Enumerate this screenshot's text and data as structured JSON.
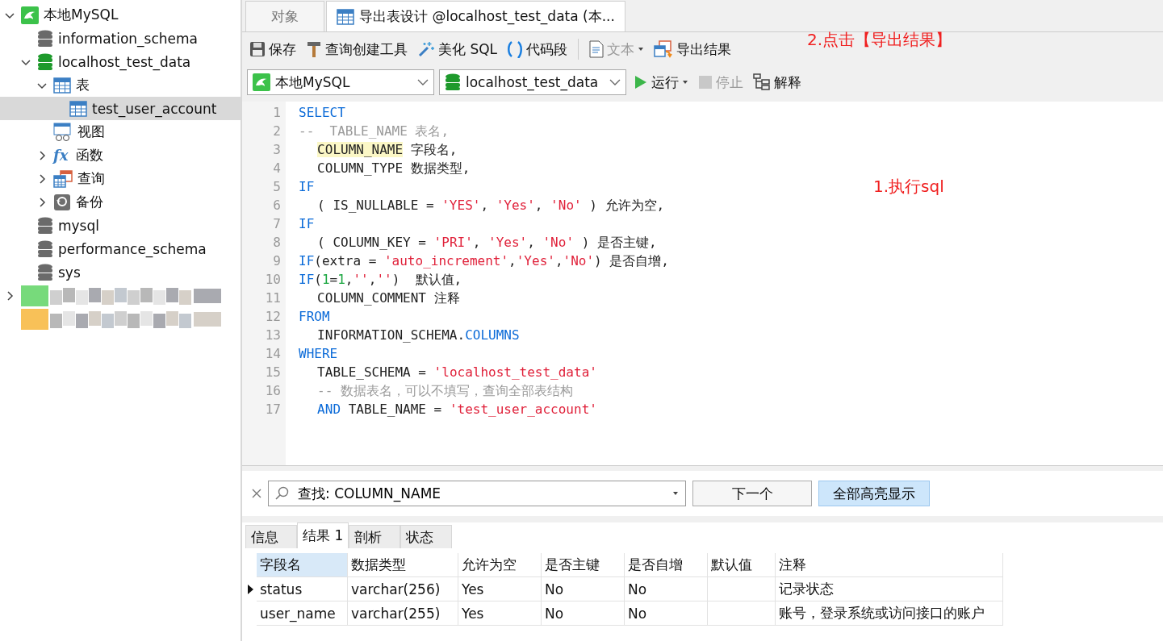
{
  "sidebar": {
    "tree": [
      {
        "label": "本地MySQL",
        "kind": "connection",
        "expanded": true,
        "selected": false,
        "children": [
          {
            "label": "information_schema",
            "kind": "database",
            "active": false,
            "selected": false
          },
          {
            "label": "localhost_test_data",
            "kind": "database",
            "active": true,
            "expanded": true,
            "selected": false,
            "children": [
              {
                "label": "表",
                "kind": "tables",
                "expanded": true,
                "selected": false,
                "children": [
                  {
                    "label": "test_user_account",
                    "kind": "table",
                    "selected": true
                  }
                ]
              },
              {
                "label": "视图",
                "kind": "views",
                "selected": false
              },
              {
                "label": "函数",
                "kind": "functions",
                "glyph": "fx",
                "expanded": false,
                "selected": false
              },
              {
                "label": "查询",
                "kind": "queries",
                "expanded": false,
                "selected": false
              },
              {
                "label": "备份",
                "kind": "backups",
                "expanded": false,
                "selected": false
              }
            ]
          },
          {
            "label": "mysql",
            "kind": "database",
            "active": false,
            "selected": false
          },
          {
            "label": "performance_schema",
            "kind": "database",
            "active": false,
            "selected": false
          },
          {
            "label": "sys",
            "kind": "database",
            "active": false,
            "selected": false
          }
        ]
      },
      {
        "kind": "redacted",
        "expanded": false
      },
      {
        "kind": "redacted"
      }
    ]
  },
  "tabs": [
    {
      "label": "对象",
      "selected": false,
      "icon": false
    },
    {
      "label": "导出表设计 @localhost_test_data (本...",
      "selected": true,
      "icon": true
    }
  ],
  "toolbar": [
    {
      "kind": "save",
      "label": "保存",
      "disabled": false
    },
    {
      "kind": "builder",
      "label": "查询创建工具",
      "disabled": false
    },
    {
      "kind": "beautify",
      "label": "美化 SQL",
      "disabled": false
    },
    {
      "kind": "snippet",
      "label": "代码段",
      "disabled": false
    },
    {
      "kind": "separator"
    },
    {
      "kind": "text",
      "label": "文本",
      "disabled": true,
      "dropdown": true
    },
    {
      "kind": "export",
      "label": "导出结果",
      "disabled": false
    }
  ],
  "query_bar": {
    "connection": "本地MySQL",
    "database": "localhost_test_data",
    "actions": [
      {
        "kind": "run",
        "label": "运行",
        "disabled": false,
        "dropdown": true
      },
      {
        "kind": "stop",
        "label": "停止",
        "disabled": true
      },
      {
        "kind": "explain",
        "label": "解释",
        "disabled": false
      }
    ]
  },
  "editor": {
    "lines": [
      {
        "number": "1",
        "indented": false,
        "tokens": [
          {
            "kind": "kw",
            "text": "SELECT"
          }
        ]
      },
      {
        "number": "2",
        "indented": false,
        "tokens": [
          {
            "kind": "comment",
            "text": "--  TABLE_NAME 表名,"
          }
        ]
      },
      {
        "number": "3",
        "indented": true,
        "tokens": [
          {
            "kind": "match",
            "text": "COLUMN_NAME"
          },
          {
            "kind": "plain",
            "text": " 字段名,"
          }
        ]
      },
      {
        "number": "4",
        "indented": true,
        "tokens": [
          {
            "kind": "plain",
            "text": "COLUMN_TYPE 数据类型,"
          }
        ]
      },
      {
        "number": "5",
        "indented": false,
        "tokens": [
          {
            "kind": "kw",
            "text": "IF"
          }
        ]
      },
      {
        "number": "6",
        "indented": true,
        "tokens": [
          {
            "kind": "plain",
            "text": "( IS_NULLABLE = "
          },
          {
            "kind": "str",
            "text": "'YES'"
          },
          {
            "kind": "plain",
            "text": ", "
          },
          {
            "kind": "str",
            "text": "'Yes'"
          },
          {
            "kind": "plain",
            "text": ", "
          },
          {
            "kind": "str",
            "text": "'No'"
          },
          {
            "kind": "plain",
            "text": " ) 允许为空,"
          }
        ]
      },
      {
        "number": "7",
        "indented": false,
        "tokens": [
          {
            "kind": "kw",
            "text": "IF"
          }
        ]
      },
      {
        "number": "8",
        "indented": true,
        "tokens": [
          {
            "kind": "plain",
            "text": "( COLUMN_KEY = "
          },
          {
            "kind": "str",
            "text": "'PRI'"
          },
          {
            "kind": "plain",
            "text": ", "
          },
          {
            "kind": "str",
            "text": "'Yes'"
          },
          {
            "kind": "plain",
            "text": ", "
          },
          {
            "kind": "str",
            "text": "'No'"
          },
          {
            "kind": "plain",
            "text": " ) 是否主键,"
          }
        ]
      },
      {
        "number": "9",
        "indented": false,
        "tokens": [
          {
            "kind": "kw",
            "text": "IF"
          },
          {
            "kind": "plain",
            "text": "(extra = "
          },
          {
            "kind": "str",
            "text": "'auto_increment'"
          },
          {
            "kind": "plain",
            "text": ","
          },
          {
            "kind": "str",
            "text": "'Yes'"
          },
          {
            "kind": "plain",
            "text": ","
          },
          {
            "kind": "str",
            "text": "'No'"
          },
          {
            "kind": "plain",
            "text": ") 是否自增,"
          }
        ]
      },
      {
        "number": "10",
        "indented": false,
        "tokens": [
          {
            "kind": "kw",
            "text": "IF"
          },
          {
            "kind": "plain",
            "text": "("
          },
          {
            "kind": "num",
            "text": "1"
          },
          {
            "kind": "plain",
            "text": "="
          },
          {
            "kind": "num",
            "text": "1"
          },
          {
            "kind": "plain",
            "text": ","
          },
          {
            "kind": "str",
            "text": "''"
          },
          {
            "kind": "plain",
            "text": ","
          },
          {
            "kind": "str",
            "text": "''"
          },
          {
            "kind": "plain",
            "text": ")  默认值,"
          }
        ]
      },
      {
        "number": "11",
        "indented": true,
        "tokens": [
          {
            "kind": "plain",
            "text": "COLUMN_COMMENT 注释"
          }
        ]
      },
      {
        "number": "12",
        "indented": false,
        "tokens": [
          {
            "kind": "kw",
            "text": "FROM"
          }
        ]
      },
      {
        "number": "13",
        "indented": true,
        "tokens": [
          {
            "kind": "plain",
            "text": "INFORMATION_SCHEMA."
          },
          {
            "kind": "kw",
            "text": "COLUMNS"
          }
        ]
      },
      {
        "number": "14",
        "indented": false,
        "tokens": [
          {
            "kind": "kw",
            "text": "WHERE"
          }
        ]
      },
      {
        "number": "15",
        "indented": true,
        "tokens": [
          {
            "kind": "plain",
            "text": "TABLE_SCHEMA = "
          },
          {
            "kind": "str",
            "text": "'localhost_test_data'"
          }
        ]
      },
      {
        "number": "16",
        "indented": true,
        "tokens": [
          {
            "kind": "comment",
            "text": "-- 数据表名，可以不填写，查询全部表结构"
          }
        ]
      },
      {
        "number": "17",
        "indented": true,
        "tokens": [
          {
            "kind": "kw",
            "text": "AND"
          },
          {
            "kind": "plain",
            "text": " TABLE_NAME = "
          },
          {
            "kind": "str",
            "text": "'test_user_account'"
          }
        ]
      }
    ]
  },
  "annotations": [
    {
      "text": "2.点击【导出结果】"
    },
    {
      "text": "1.执行sql"
    }
  ],
  "find_bar": {
    "value": "查找: COLUMN_NAME",
    "next": "下一个",
    "highlight_all": {
      "label": "全部高亮显示",
      "on": true
    }
  },
  "result_tabs": [
    {
      "label": "信息",
      "selected": false
    },
    {
      "label": "结果 1",
      "selected": true
    },
    {
      "label": "剖析",
      "selected": false
    },
    {
      "label": "状态",
      "selected": false
    }
  ],
  "table": {
    "columns": [
      {
        "label": "字段名",
        "selected": true
      },
      {
        "label": "数据类型",
        "selected": false
      },
      {
        "label": "允许为空",
        "selected": false
      },
      {
        "label": "是否主键",
        "selected": false
      },
      {
        "label": "是否自增",
        "selected": false
      },
      {
        "label": "默认值",
        "selected": false
      },
      {
        "label": "注释",
        "selected": false
      }
    ],
    "rows": [
      {
        "current": true,
        "cells": [
          "status",
          "varchar(256)",
          "Yes",
          "No",
          "No",
          "",
          "记录状态"
        ]
      },
      {
        "current": false,
        "cells": [
          "user_name",
          "varchar(255)",
          "Yes",
          "No",
          "No",
          "",
          "账号，登录系统或访问接口的账户"
        ]
      }
    ]
  }
}
